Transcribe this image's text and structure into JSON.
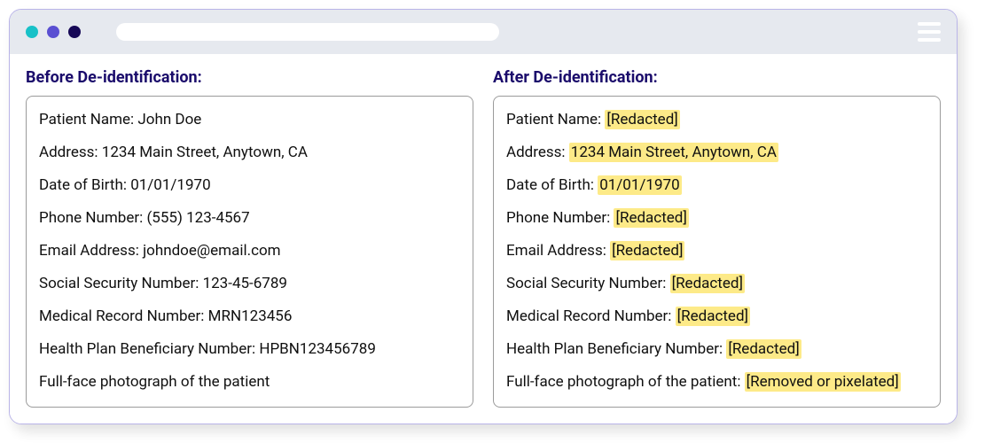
{
  "titles": {
    "before": "Before De-identification:",
    "after": "After De-identification:"
  },
  "before": [
    {
      "label": "Patient Name:",
      "value": "John Doe"
    },
    {
      "label": "Address:",
      "value": "1234 Main Street, Anytown, CA"
    },
    {
      "label": "Date of Birth:",
      "value": "01/01/1970"
    },
    {
      "label": "Phone Number:",
      "value": "(555) 123-4567"
    },
    {
      "label": "Email Address:",
      "value": "johndoe@email.com"
    },
    {
      "label": "Social Security Number:",
      "value": "123-45-6789"
    },
    {
      "label": "Medical Record Number:",
      "value": "MRN123456"
    },
    {
      "label": "Health Plan Beneficiary Number:",
      "value": "HPBN123456789"
    },
    {
      "label": "Full-face photograph of the patient",
      "value": ""
    }
  ],
  "after": [
    {
      "label": "Patient Name:",
      "value": "[Redacted]"
    },
    {
      "label": "Address:",
      "value": "1234 Main Street, Anytown, CA"
    },
    {
      "label": "Date of Birth:",
      "value": "01/01/1970"
    },
    {
      "label": "Phone Number:",
      "value": "[Redacted]"
    },
    {
      "label": "Email Address:",
      "value": "[Redacted]"
    },
    {
      "label": "Social Security Number:",
      "value": "[Redacted]"
    },
    {
      "label": "Medical Record Number:",
      "value": "[Redacted]"
    },
    {
      "label": "Health Plan Beneficiary Number:",
      "value": "[Redacted]"
    },
    {
      "label": "Full-face photograph of the patient:",
      "value": "[Removed or pixelated]"
    }
  ]
}
